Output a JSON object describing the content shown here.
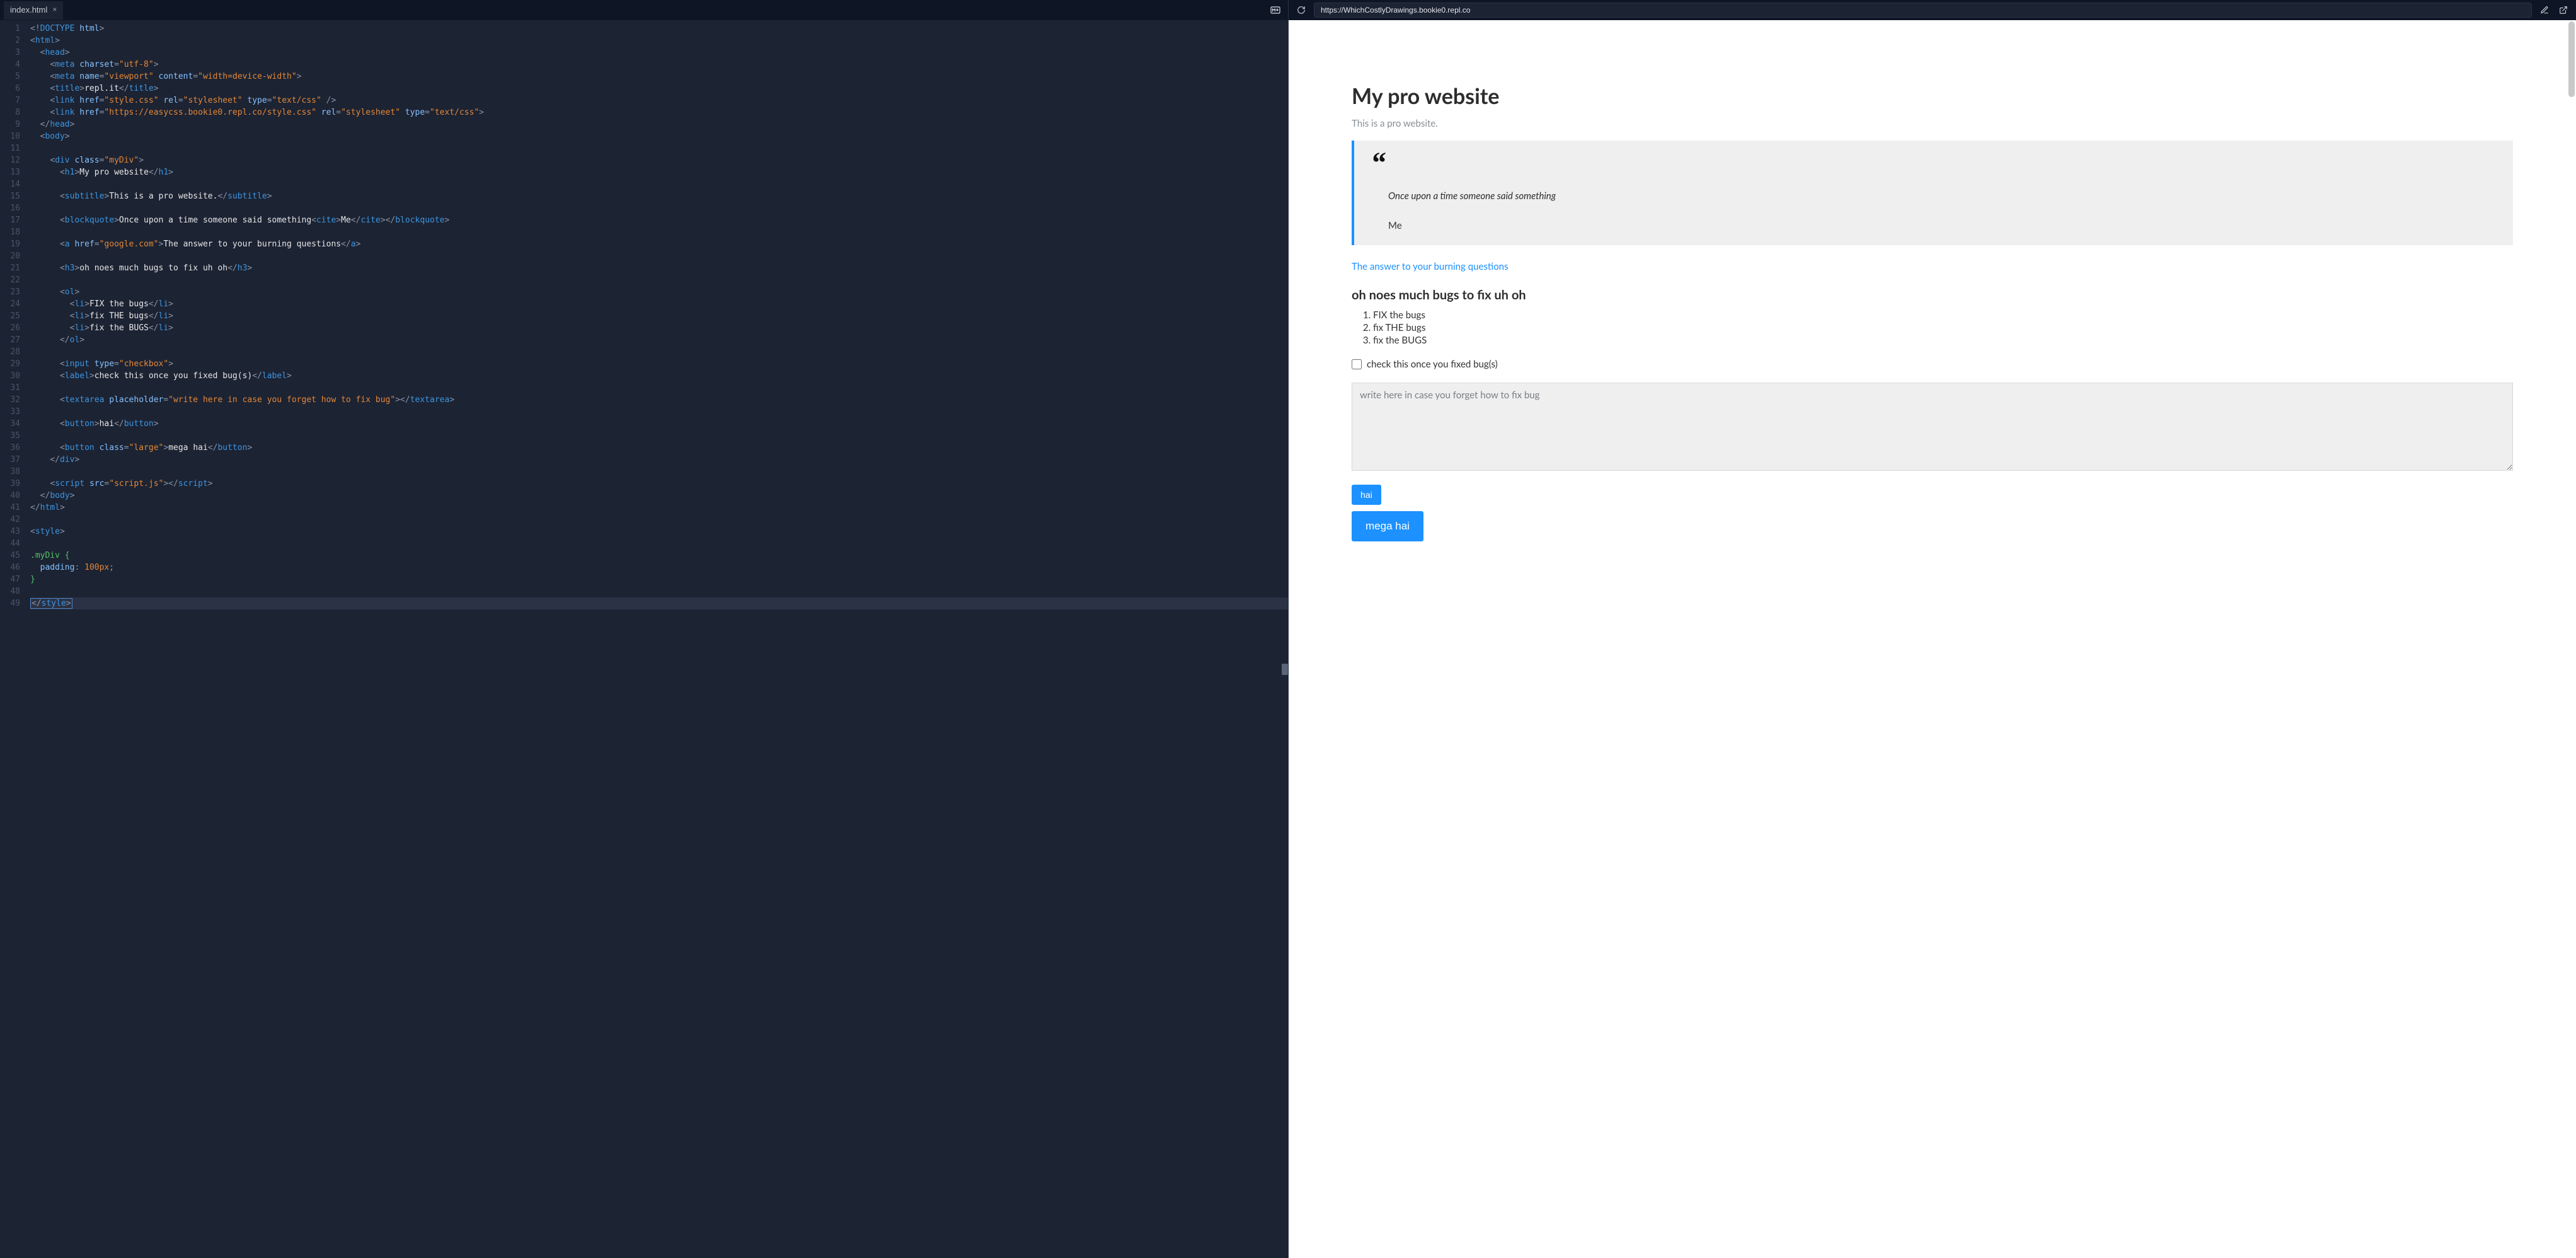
{
  "editor": {
    "tab_name": "index.html",
    "lines": {
      "count": 49,
      "highlighted": 49
    }
  },
  "urlbar": {
    "url": "https://WhichCostlyDrawings.bookie0.repl.co"
  },
  "code_text": {
    "l1_doctype": "<!DOCTYPE html>",
    "l5_viewport": "width=device-width",
    "l6_title": "repl.it",
    "l7_href": "style.css",
    "l7_rel": "stylesheet",
    "l7_type": "text/css",
    "l8_href": "https://easycss.bookie0.repl.co/style.css",
    "l12_class": "myDiv",
    "l13_h1": "My pro website",
    "l15_sub": "This is a pro website.",
    "l17_quote": "Once upon a time someone said something",
    "l17_cite": "Me",
    "l19_href": "google.com",
    "l19_link": "The answer to your burning questions",
    "l21_h3": "oh noes much bugs to fix uh oh",
    "l24_li": "FIX the bugs",
    "l25_li": "fix THE bugs",
    "l26_li": "fix the BUGS",
    "l29_type": "checkbox",
    "l30_label": "check this once you fixed bug(s)",
    "l32_ph": "write here in case you forget how to fix bug",
    "l34_btn": "hai",
    "l36_class": "large",
    "l36_btn": "mega hai",
    "l39_src": "script.js",
    "l45_sel": ".myDiv {",
    "l46_rule": "  padding: 100px;",
    "l47_close": "}"
  },
  "preview": {
    "h1": "My pro website",
    "subtitle": "This is a pro website.",
    "quote": "Once upon a time someone said something",
    "cite": "Me",
    "link": "The answer to your burning questions",
    "h3": "oh noes much bugs to fix uh oh",
    "list": [
      "FIX the bugs",
      "fix THE bugs",
      "fix the BUGS"
    ],
    "checkbox_label": "check this once you fixed bug(s)",
    "textarea_placeholder": "write here in case you forget how to fix bug",
    "button_small": "hai",
    "button_large": "mega hai"
  }
}
